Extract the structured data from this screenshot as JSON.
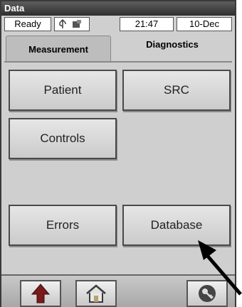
{
  "window": {
    "title": "Data"
  },
  "status_bar": {
    "state": "Ready",
    "time": "21:47",
    "date": "10-Dec",
    "icons": [
      "usb-icon",
      "network-icon"
    ]
  },
  "tabs": [
    {
      "label": "Measurement",
      "selected": false
    },
    {
      "label": "Diagnostics",
      "selected": true
    }
  ],
  "buttons": {
    "patient": "Patient",
    "src": "SRC",
    "controls": "Controls",
    "errors": "Errors",
    "database": "Database"
  },
  "bottom_nav": {
    "icons": [
      "up-arrow-icon",
      "home-icon",
      "key-icon"
    ]
  },
  "annotation": {
    "arrow_target": "Database"
  },
  "colors": {
    "title_bar": "#3a3a3a",
    "panel": "#cfcfcf",
    "button": "#dcdcdc"
  }
}
